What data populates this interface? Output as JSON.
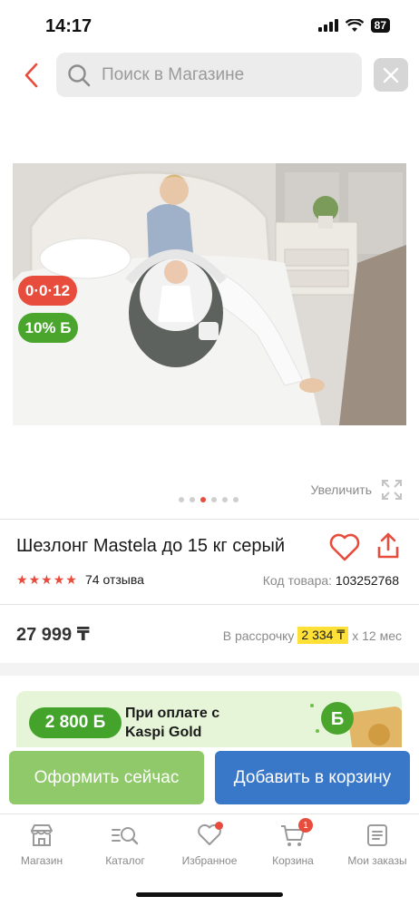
{
  "status_bar": {
    "time": "14:17",
    "battery": "87"
  },
  "search": {
    "placeholder": "Поиск в Магазине"
  },
  "product": {
    "badge_installment": "0·0·12",
    "badge_bonus": "10% Б",
    "zoom_label": "Увеличить",
    "image_count": 6,
    "active_image": 3,
    "title": "Шезлонг Mastela до 15 кг серый",
    "rating": 5,
    "reviews": "74 отзыва",
    "code_label": "Код товара:",
    "code_value": "103252768",
    "price": "27 999 ₸",
    "installment_prefix": "В рассрочку",
    "installment_amount": "2 334 ₸",
    "installment_suffix": "х 12 мес"
  },
  "promo": {
    "bonus": "2 800 Б",
    "text_line1": "При оплате с",
    "text_line2": "Kaspi Gold"
  },
  "actions": {
    "checkout": "Оформить сейчас",
    "add_to_cart": "Добавить в корзину"
  },
  "tabbar": {
    "items": [
      {
        "label": "Магазин",
        "icon": "shop-icon"
      },
      {
        "label": "Каталог",
        "icon": "catalog-search-icon"
      },
      {
        "label": "Избранное",
        "icon": "heart-icon"
      },
      {
        "label": "Корзина",
        "icon": "cart-icon",
        "badge": "1"
      },
      {
        "label": "Мои заказы",
        "icon": "orders-icon"
      }
    ]
  },
  "colors": {
    "accent_red": "#e74c3c",
    "green": "#4aa52c",
    "blue": "#3977c8",
    "light_green": "#8fc96a",
    "yellow": "#ffe036"
  }
}
